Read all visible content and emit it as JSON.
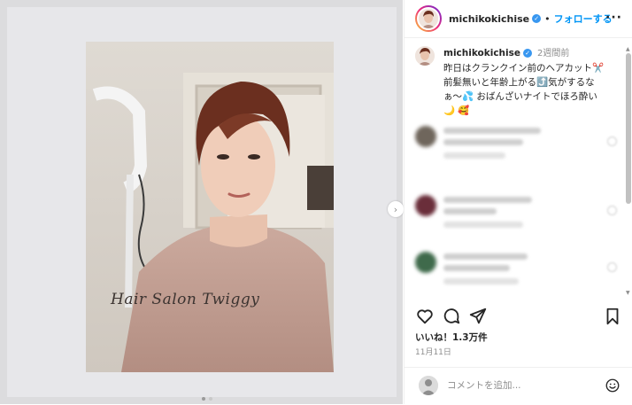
{
  "post": {
    "watermark": "Hair Salon Twiggy"
  },
  "header": {
    "username": "michikokichise",
    "separator": "•",
    "follow_label": "フォローする",
    "more_label": "···"
  },
  "caption": {
    "username": "michikokichise",
    "time": "2週間前",
    "text": "昨日はクランクイン前のヘアカット✂️\n前髪無いと年齢上がる⤴️気がするな\nぁ〜💦 おばんざいナイトでほろ酔い\n🌙 🥰"
  },
  "actions": {
    "likes": "いいね！1.3万件",
    "date": "11月11日"
  },
  "comment_box": {
    "placeholder": "コメントを追加..."
  },
  "colors": {
    "accent": "#0095f6",
    "verified": "#3897f0",
    "secondary_text": "#8e8e8e"
  },
  "icons": {
    "verified": "verified-badge-icon",
    "like": "heart-icon",
    "comment": "comment-bubble-icon",
    "share": "paper-plane-icon",
    "save": "bookmark-icon",
    "emoji": "smiley-icon",
    "next": "chevron-right-icon"
  }
}
